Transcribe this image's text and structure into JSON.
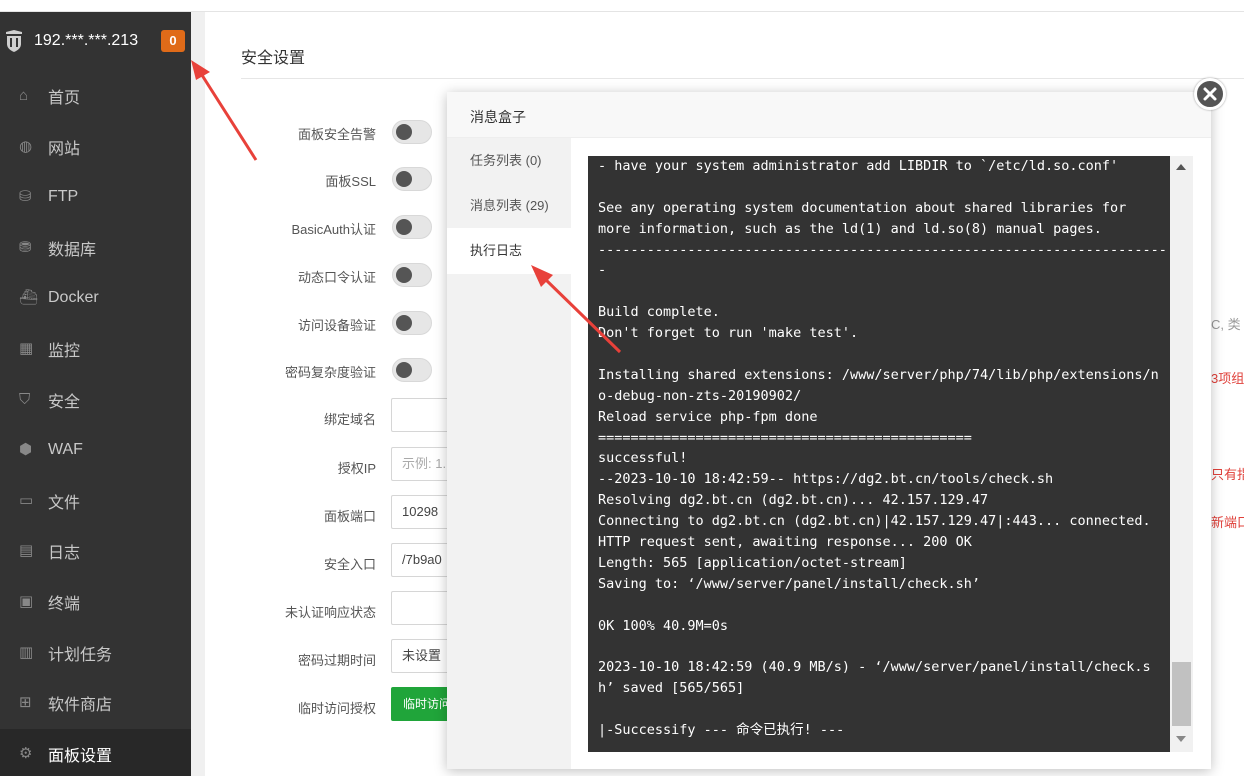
{
  "sidebar": {
    "server_ip": "192.***.***.213",
    "notice_count": "0",
    "items": [
      {
        "label": "首页",
        "icon": "home-icon"
      },
      {
        "label": "网站",
        "icon": "globe-icon"
      },
      {
        "label": "FTP",
        "icon": "ftp-icon"
      },
      {
        "label": "数据库",
        "icon": "database-icon"
      },
      {
        "label": "Docker",
        "icon": "docker-icon"
      },
      {
        "label": "监控",
        "icon": "monitor-icon"
      },
      {
        "label": "安全",
        "icon": "shield-icon"
      },
      {
        "label": "WAF",
        "icon": "waf-icon"
      },
      {
        "label": "文件",
        "icon": "folder-icon"
      },
      {
        "label": "日志",
        "icon": "log-icon"
      },
      {
        "label": "终端",
        "icon": "terminal-icon"
      },
      {
        "label": "计划任务",
        "icon": "calendar-icon"
      },
      {
        "label": "软件商店",
        "icon": "apps-icon"
      },
      {
        "label": "面板设置",
        "icon": "gear-icon"
      }
    ],
    "active_index": 13
  },
  "main": {
    "title": "安全设置",
    "settings": [
      {
        "label": "面板安全告警",
        "type": "toggle"
      },
      {
        "label": "面板SSL",
        "type": "toggle"
      },
      {
        "label": "BasicAuth认证",
        "type": "toggle"
      },
      {
        "label": "动态口令认证",
        "type": "toggle"
      },
      {
        "label": "访问设备验证",
        "type": "toggle"
      },
      {
        "label": "密码复杂度验证",
        "type": "toggle"
      },
      {
        "label": "绑定域名",
        "type": "input",
        "value": ""
      },
      {
        "label": "授权IP",
        "type": "input",
        "placeholder": "示例: 1."
      },
      {
        "label": "面板端口",
        "type": "input",
        "value": "10298"
      },
      {
        "label": "安全入口",
        "type": "input",
        "value": "/7b9a0"
      },
      {
        "label": "未认证响应状态",
        "type": "input",
        "value": ""
      },
      {
        "label": "密码过期时间",
        "type": "input",
        "value": "未设置"
      },
      {
        "label": "临时访问授权",
        "type": "button",
        "value": "临时访问"
      }
    ],
    "edge_notes": [
      {
        "text": "C, 类",
        "color": "#999999"
      },
      {
        "text": "3项组",
        "color": "#e0403a"
      },
      {
        "text": "只有指",
        "color": "#e0403a"
      },
      {
        "text": "新端口",
        "color": "#e0403a"
      }
    ]
  },
  "modal": {
    "title": "消息盒子",
    "tabs": [
      {
        "label": "任务列表 (0)"
      },
      {
        "label": "消息列表 (29)"
      },
      {
        "label": "执行日志"
      }
    ],
    "active_tab": 2,
    "log_lines": [
      "- have your system administrator add LIBDIR to `/etc/ld.so.conf'",
      "",
      "See any operating system documentation about shared libraries for",
      "more information, such as the ld(1) and ld.so(8) manual pages.",
      "----------------------------------------------------------------------",
      "-",
      "",
      "Build complete.",
      "Don't forget to run 'make test'.",
      "",
      "Installing shared extensions: /www/server/php/74/lib/php/extensions/n",
      "o-debug-non-zts-20190902/",
      "Reload service php-fpm done",
      "==============================================",
      "successful!",
      "--2023-10-10 18:42:59-- https://dg2.bt.cn/tools/check.sh",
      "Resolving dg2.bt.cn (dg2.bt.cn)... 42.157.129.47",
      "Connecting to dg2.bt.cn (dg2.bt.cn)|42.157.129.47|:443... connected.",
      "HTTP request sent, awaiting response... 200 OK",
      "Length: 565 [application/octet-stream]",
      "Saving to: ‘/www/server/panel/install/check.sh’",
      "",
      "0K 100% 40.9M=0s",
      "",
      "2023-10-10 18:42:59 (40.9 MB/s) - ‘/www/server/panel/install/check.s",
      "h’ saved [565/565]",
      "",
      "|-Successify --- 命令已执行! ---"
    ]
  },
  "colors": {
    "sidebar_bg": "#333333",
    "badge": "#e06b19",
    "console_bg": "#333333",
    "accent_green": "#20a53a",
    "arrow_red": "#e8413a"
  }
}
